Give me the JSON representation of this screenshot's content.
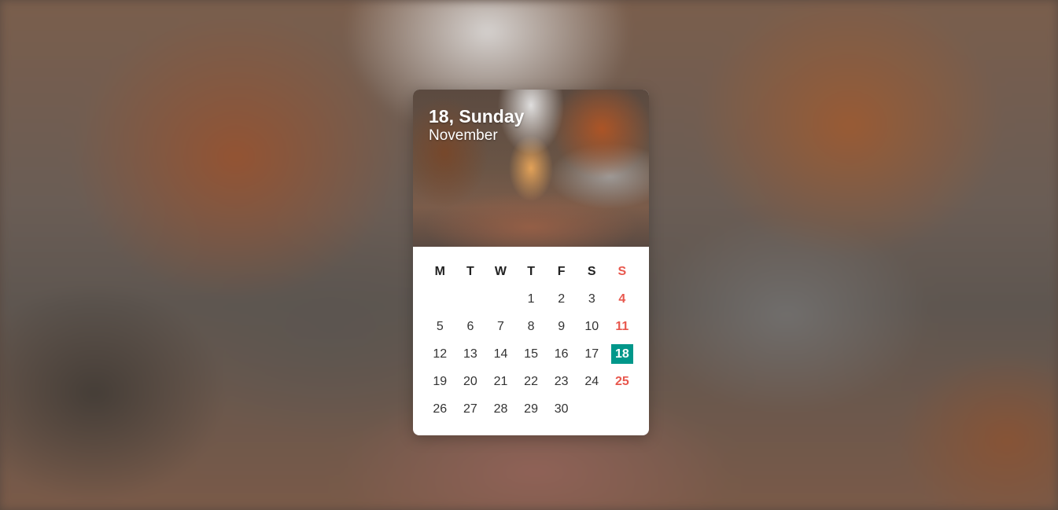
{
  "header": {
    "date_line": "18, Sunday",
    "month": "November"
  },
  "weekdays": [
    "M",
    "T",
    "W",
    "T",
    "F",
    "S",
    "S"
  ],
  "weeks": [
    [
      "",
      "",
      "",
      "1",
      "2",
      "3",
      "4"
    ],
    [
      "5",
      "6",
      "7",
      "8",
      "9",
      "10",
      "11"
    ],
    [
      "12",
      "13",
      "14",
      "15",
      "16",
      "17",
      "18"
    ],
    [
      "19",
      "20",
      "21",
      "22",
      "23",
      "24",
      "25"
    ],
    [
      "26",
      "27",
      "28",
      "29",
      "30",
      "",
      ""
    ]
  ],
  "today": "18",
  "colors": {
    "weekend": "#e8574d",
    "today_bg": "#00978a",
    "text": "#333333"
  }
}
